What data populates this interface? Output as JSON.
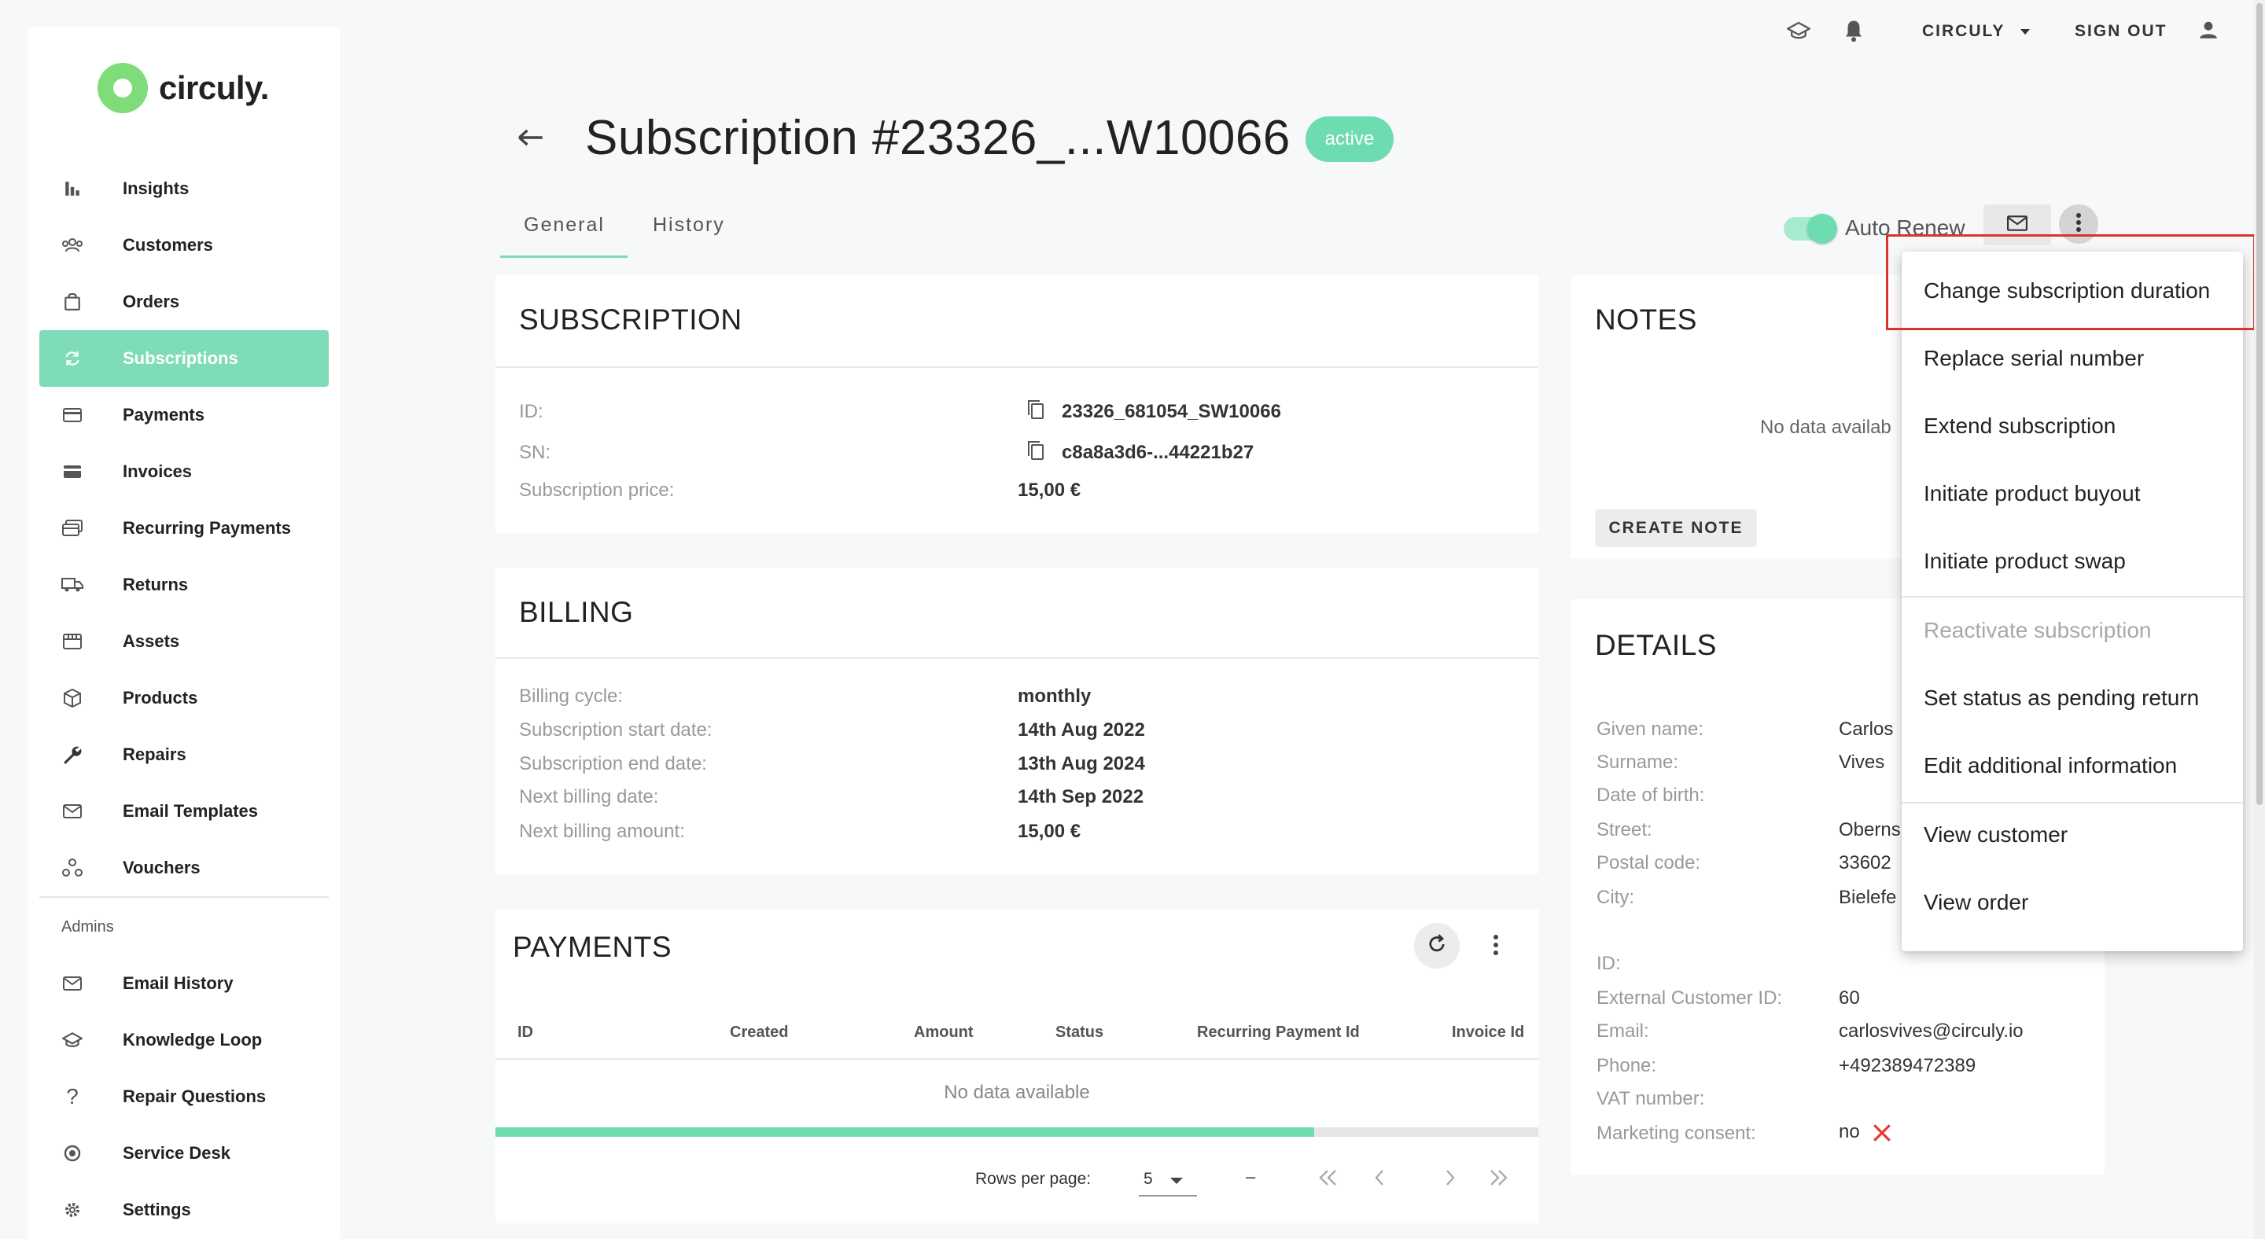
{
  "topbar": {
    "org_label": "CIRCULY",
    "signout_label": "SIGN OUT"
  },
  "sidebar": {
    "logo_text": "circuly.",
    "items": [
      {
        "label": "Insights",
        "icon": "bar-chart-icon"
      },
      {
        "label": "Customers",
        "icon": "people-icon"
      },
      {
        "label": "Orders",
        "icon": "bag-icon"
      },
      {
        "label": "Subscriptions",
        "icon": "sync-icon",
        "active": true
      },
      {
        "label": "Payments",
        "icon": "card-icon"
      },
      {
        "label": "Invoices",
        "icon": "invoice-icon"
      },
      {
        "label": "Recurring Payments",
        "icon": "recurring-icon"
      },
      {
        "label": "Returns",
        "icon": "truck-icon"
      },
      {
        "label": "Assets",
        "icon": "assets-icon"
      },
      {
        "label": "Products",
        "icon": "cube-icon"
      },
      {
        "label": "Repairs",
        "icon": "wrench-icon"
      },
      {
        "label": "Email Templates",
        "icon": "mail-icon"
      },
      {
        "label": "Vouchers",
        "icon": "vouchers-icon"
      }
    ],
    "admins_label": "Admins",
    "admin_items": [
      {
        "label": "Email History",
        "icon": "mail-icon"
      },
      {
        "label": "Knowledge Loop",
        "icon": "graduation-cap-icon"
      },
      {
        "label": "Repair Questions",
        "icon": "question-icon"
      },
      {
        "label": "Service Desk",
        "icon": "support-icon"
      },
      {
        "label": "Settings",
        "icon": "gear-icon"
      }
    ]
  },
  "header": {
    "title": "Subscription #23326_...W10066",
    "status": "active",
    "tabs": [
      "General",
      "History"
    ],
    "auto_renew_label": "Auto Renew",
    "auto_renew_on": true
  },
  "subscription": {
    "heading": "SUBSCRIPTION",
    "rows": [
      {
        "label": "ID:",
        "value": "23326_681054_SW10066"
      },
      {
        "label": "SN:",
        "value": "c8a8a3d6-...44221b27"
      },
      {
        "label": "Subscription price:",
        "value": "15,00 €"
      }
    ]
  },
  "billing": {
    "heading": "BILLING",
    "rows": [
      {
        "label": "Billing cycle:",
        "value": "monthly"
      },
      {
        "label": "Subscription start date:",
        "value": "14th Aug 2022"
      },
      {
        "label": "Subscription end date:",
        "value": "13th Aug 2024"
      },
      {
        "label": "Next billing date:",
        "value": "14th Sep 2022"
      },
      {
        "label": "Next billing amount:",
        "value": "15,00 €"
      }
    ]
  },
  "payments": {
    "heading": "PAYMENTS",
    "columns": [
      "ID",
      "Created",
      "Amount",
      "Status",
      "Recurring Payment Id",
      "Invoice Id"
    ],
    "empty_text": "No data available",
    "progress": 0.785,
    "rows_per_page_label": "Rows per page:",
    "rows_per_page": "5",
    "range_text": "–"
  },
  "notes": {
    "heading": "NOTES",
    "empty_text": "No data availab",
    "create_label": "CREATE NOTE"
  },
  "details": {
    "heading": "DETAILS",
    "rows": [
      {
        "label": "Given name:",
        "value": "Carlos"
      },
      {
        "label": "Surname:",
        "value": "Vives"
      },
      {
        "label": "Date of birth:",
        "value": ""
      },
      {
        "label": "Street:",
        "value": "Oberns"
      },
      {
        "label": "Postal code:",
        "value": "33602"
      },
      {
        "label": "City:",
        "value": "Bielefe"
      },
      {
        "label": "ID:",
        "value": ""
      },
      {
        "label": "External Customer ID:",
        "value": "60"
      },
      {
        "label": "Email:",
        "value": "carlosvives@circuly.io"
      },
      {
        "label": "Phone:",
        "value": "+492389472389"
      },
      {
        "label": "VAT number:",
        "value": ""
      },
      {
        "label": "Marketing consent:",
        "value": "no"
      }
    ]
  },
  "menu": {
    "items": [
      {
        "label": "Change subscription duration",
        "disabled": false
      },
      {
        "label": "Replace serial number",
        "disabled": false
      },
      {
        "label": "Extend subscription",
        "disabled": false
      },
      {
        "label": "Initiate product buyout",
        "disabled": false
      },
      {
        "label": "Initiate product swap",
        "disabled": false
      },
      {
        "label": "Reactivate subscription",
        "disabled": true
      },
      {
        "label": "Set status as pending return",
        "disabled": false
      },
      {
        "label": "Edit additional information",
        "disabled": false
      },
      {
        "label": "View customer",
        "disabled": false
      },
      {
        "label": "View order",
        "disabled": false
      }
    ]
  },
  "colors": {
    "accent": "#6ddcb0",
    "sidebar_active": "#7fdcb8",
    "highlight": "#d9352c",
    "consent_no": "#e53935"
  }
}
